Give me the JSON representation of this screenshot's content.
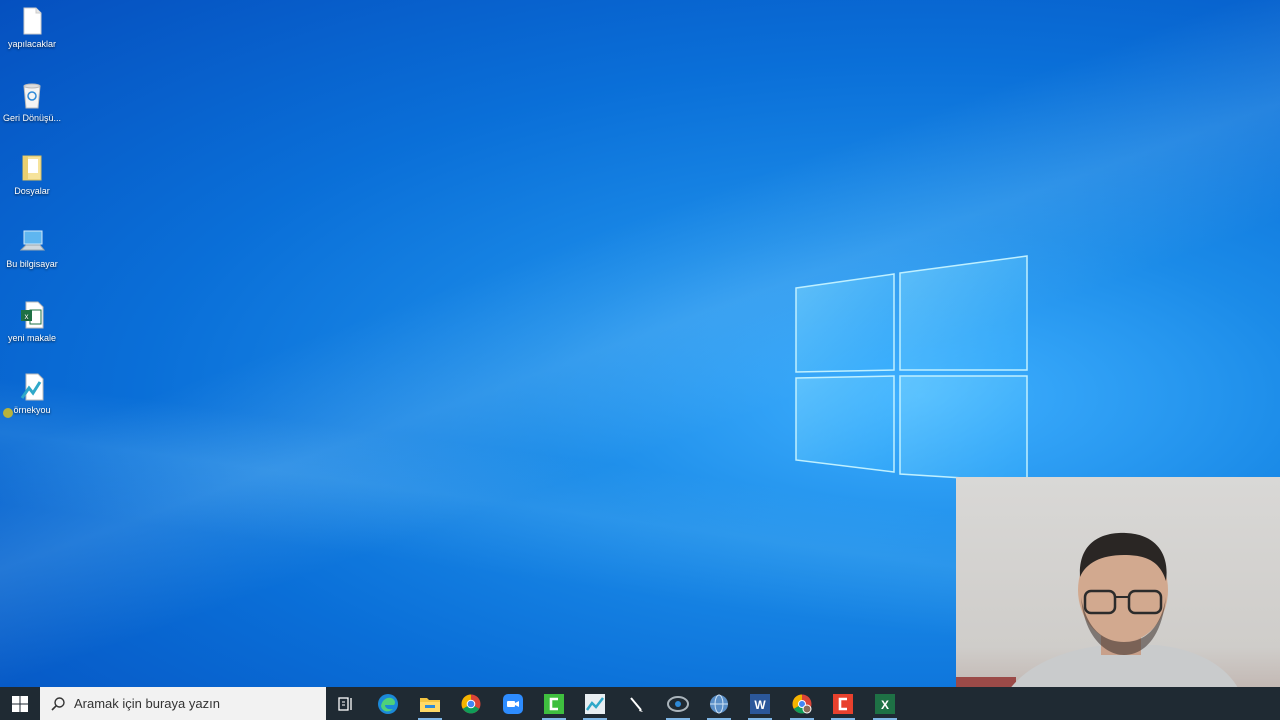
{
  "desktop": {
    "icons": [
      {
        "label": "yapılacaklar",
        "icon": "text-document-icon"
      },
      {
        "label": "Geri Dönüşü...",
        "icon": "recycle-bin-icon"
      },
      {
        "label": "Dosyalar",
        "icon": "folder-icon"
      },
      {
        "label": "Bu bilgisayar",
        "icon": "computer-icon"
      },
      {
        "label": "yeni makale",
        "icon": "excel-file-icon"
      },
      {
        "label": "örnekyou",
        "icon": "chart-file-icon"
      }
    ]
  },
  "taskbar": {
    "search_placeholder": "Aramak için buraya yazın",
    "apps": [
      {
        "name": "task-view",
        "icon": "task-view-icon"
      },
      {
        "name": "edge",
        "icon": "edge-icon"
      },
      {
        "name": "file-explorer",
        "icon": "folder-icon"
      },
      {
        "name": "chrome",
        "icon": "chrome-icon"
      },
      {
        "name": "zoom",
        "icon": "zoom-icon"
      },
      {
        "name": "camtasia",
        "icon": "camtasia-icon"
      },
      {
        "name": "app-10",
        "icon": "chart-app-icon"
      },
      {
        "name": "pen-tool",
        "icon": "pen-icon"
      },
      {
        "name": "recorder",
        "icon": "recorder-icon"
      },
      {
        "name": "network-app",
        "icon": "globe-icon"
      },
      {
        "name": "word",
        "icon": "word-icon"
      },
      {
        "name": "chrome-profile",
        "icon": "chrome-profile-icon"
      },
      {
        "name": "camtasia-recorder",
        "icon": "recorder-red-icon"
      },
      {
        "name": "excel",
        "icon": "excel-icon"
      }
    ]
  },
  "colors": {
    "desktop_blue": "#0a6fd8",
    "taskbar": "#1f2a33",
    "active_indicator": "#7fb6e6"
  }
}
